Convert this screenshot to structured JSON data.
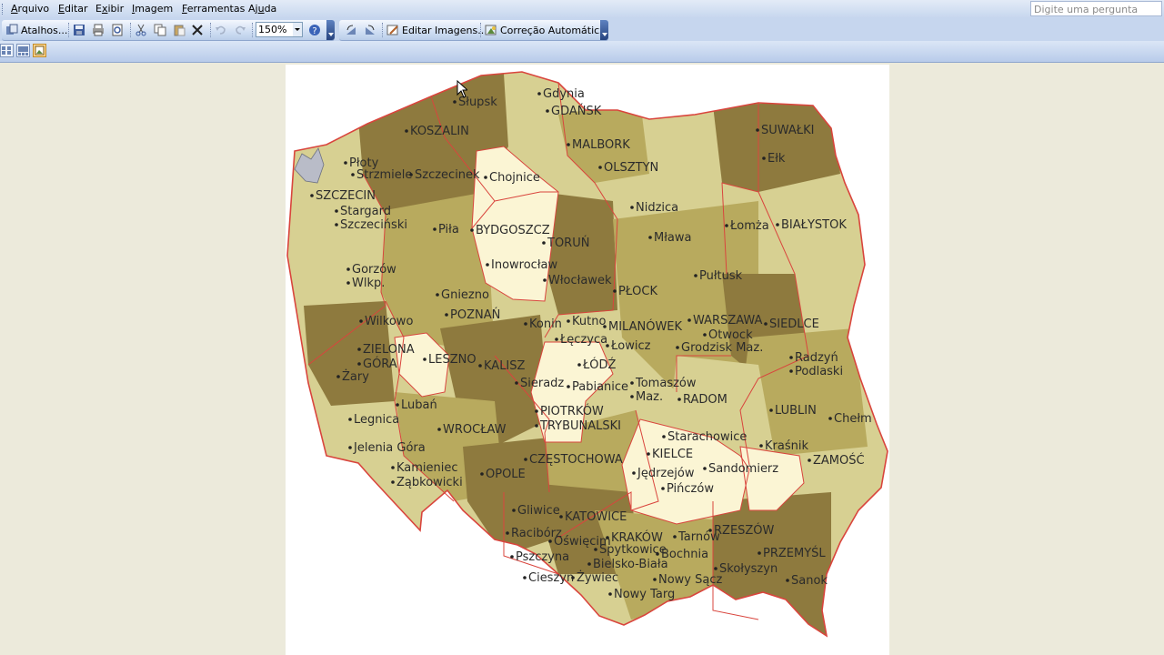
{
  "menu": {
    "items": [
      {
        "pre": "",
        "acc": "A",
        "post": "rquivo"
      },
      {
        "pre": "",
        "acc": "E",
        "post": "ditar"
      },
      {
        "pre": "E",
        "acc": "x",
        "post": "ibir"
      },
      {
        "pre": "",
        "acc": "I",
        "post": "magem"
      },
      {
        "pre": "",
        "acc": "F",
        "post": "erramentas"
      },
      {
        "pre": "Aj",
        "acc": "u",
        "post": "da"
      }
    ],
    "ask_placeholder": "Digite uma pergunta"
  },
  "toolbar": {
    "shortcuts_label": "Atalhos...",
    "zoom_value": "150%",
    "edit_images_label": "Editar Imagens...",
    "autocorrect_label": "Correção Automática"
  },
  "map": {
    "cities": [
      "Gdynia",
      "GDAŃSK",
      "Słupsk",
      "KOSZALIN",
      "MALBORK",
      "SUWAŁKI",
      "Płoty",
      "Strzmiele",
      "Szczecinek",
      "Chojnice",
      "OLSZTYN",
      "Ełk",
      "SZCZECIN",
      "Stargard",
      "Szczeciński",
      "Nidzica",
      "BYDGOSZCZ",
      "Piła",
      "Łomża",
      "BIAŁYSTOK",
      "TORUŃ",
      "Mława",
      "Gorzów",
      "Wlkp.",
      "Inowrocław",
      "Włocławek",
      "Pułtusk",
      "Gniezno",
      "PŁOCK",
      "POZNAŃ",
      "Konin",
      "Kutno",
      "MILANÓWEK",
      "WARSZAWA",
      "SIEDLCE",
      "Wilkowo",
      "Łęczyca",
      "Otwock",
      "ZIELONA",
      "GÓRA",
      "LESZNO",
      "Łowicz",
      "Grodzisk Maz.",
      "Radzyń",
      "Podlaski",
      "Żary",
      "KALISZ",
      "ŁÓDŹ",
      "Sieradz",
      "Pabianice",
      "Tomaszów",
      "Maz.",
      "Lubań",
      "RADOM",
      "LUBLIN",
      "PIOTRKÓW",
      "TRYBUNALSKI",
      "Legnica",
      "WROCŁAW",
      "Chełm",
      "Starachowice",
      "Kraśnik",
      "KIELCE",
      "Jelenia Góra",
      "CZĘSTOCHOWA",
      "ZAMOŚĆ",
      "Kamieniec",
      "Ząbkowicki",
      "OPOLE",
      "Jędrzejów",
      "Sandomierz",
      "Pińczów",
      "Gliwice",
      "KATOWICE",
      "RZESZÓW",
      "Racibórz",
      "Oświęcim",
      "KRAKÓW",
      "Tarnów",
      "Spytkowice",
      "PRZEMYŚL",
      "Pszczyna",
      "Bielsko-Biała",
      "Bochnia",
      "Skołyszyn",
      "Cieszyn",
      "Żywiec",
      "Nowy Sącz",
      "Sanok",
      "Nowy Targ"
    ],
    "colors": {
      "light": "#d7d092",
      "mid": "#b8aa5e",
      "dark": "#8e7a3e",
      "pale": "#fbf5d4",
      "border": "#d9453d"
    }
  }
}
